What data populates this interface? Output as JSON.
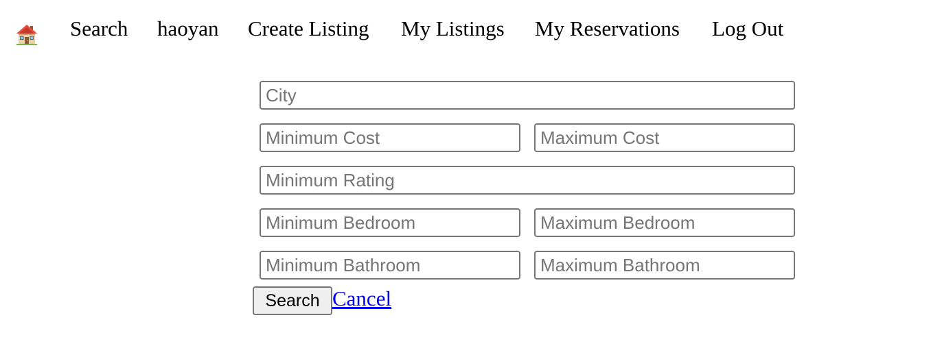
{
  "nav": {
    "home_icon": "house-icon",
    "search": "Search",
    "username": "haoyan",
    "create_listing": "Create Listing",
    "my_listings": "My Listings",
    "my_reservations": "My Reservations",
    "log_out": "Log Out"
  },
  "form": {
    "city": {
      "placeholder": "City",
      "value": ""
    },
    "min_cost": {
      "placeholder": "Minimum Cost",
      "value": ""
    },
    "max_cost": {
      "placeholder": "Maximum Cost",
      "value": ""
    },
    "min_rating": {
      "placeholder": "Minimum Rating",
      "value": ""
    },
    "min_bedroom": {
      "placeholder": "Minimum Bedroom",
      "value": ""
    },
    "max_bedroom": {
      "placeholder": "Maximum Bedroom",
      "value": ""
    },
    "min_bathroom": {
      "placeholder": "Minimum Bathroom",
      "value": ""
    },
    "max_bathroom": {
      "placeholder": "Maximum Bathroom",
      "value": ""
    },
    "search_button": "Search",
    "cancel_link": "Cancel"
  },
  "colors": {
    "link": "#0000ee",
    "input_border": "#767676",
    "button_bg": "#efefef",
    "placeholder": "#757575"
  }
}
